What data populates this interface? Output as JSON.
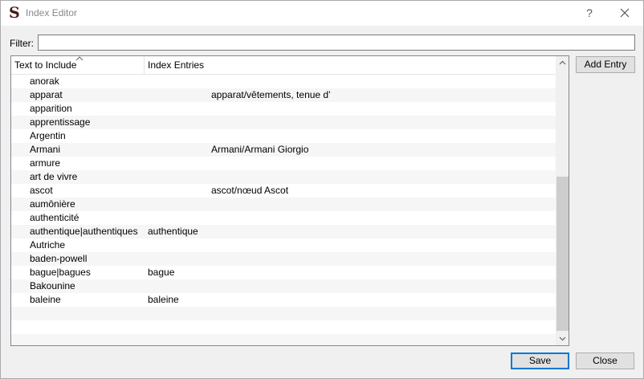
{
  "window": {
    "title": "Index Editor",
    "help_label": "?"
  },
  "filter": {
    "label": "Filter:",
    "value": "",
    "placeholder": ""
  },
  "table": {
    "columns": [
      "Text to Include",
      "Index Entries"
    ],
    "rows": [
      {
        "text": "anorak",
        "entry": "",
        "extra": ""
      },
      {
        "text": "apparat",
        "entry": "",
        "extra": "apparat/vêtements, tenue d'"
      },
      {
        "text": "apparition",
        "entry": "",
        "extra": ""
      },
      {
        "text": "apprentissage",
        "entry": "",
        "extra": ""
      },
      {
        "text": "Argentin",
        "entry": "",
        "extra": ""
      },
      {
        "text": "Armani",
        "entry": "",
        "extra": "Armani/Armani Giorgio"
      },
      {
        "text": "armure",
        "entry": "",
        "extra": ""
      },
      {
        "text": "art de vivre",
        "entry": "",
        "extra": ""
      },
      {
        "text": "ascot",
        "entry": "",
        "extra": "ascot/nœud Ascot"
      },
      {
        "text": "aumônière",
        "entry": "",
        "extra": ""
      },
      {
        "text": "authenticité",
        "entry": "",
        "extra": ""
      },
      {
        "text": "authentique|authentiques",
        "entry": "authentique",
        "extra": ""
      },
      {
        "text": "Autriche",
        "entry": "",
        "extra": ""
      },
      {
        "text": "baden-powell",
        "entry": "",
        "extra": ""
      },
      {
        "text": "bague|bagues",
        "entry": "bague",
        "extra": ""
      },
      {
        "text": "Bakounine",
        "entry": "",
        "extra": ""
      },
      {
        "text": "baleine",
        "entry": "baleine",
        "extra": ""
      }
    ]
  },
  "buttons": {
    "add_entry": "Add Entry",
    "save": "Save",
    "close": "Close"
  },
  "icons": {
    "app": "app-s-icon",
    "close": "close-icon",
    "sort": "sort-ascending-icon",
    "scroll_up": "chevron-up-icon",
    "scroll_down": "chevron-down-icon"
  },
  "colors": {
    "accent": "#0078d7",
    "alt_row": "#f6f6f6",
    "scroll_thumb": "#cdcdcd"
  }
}
